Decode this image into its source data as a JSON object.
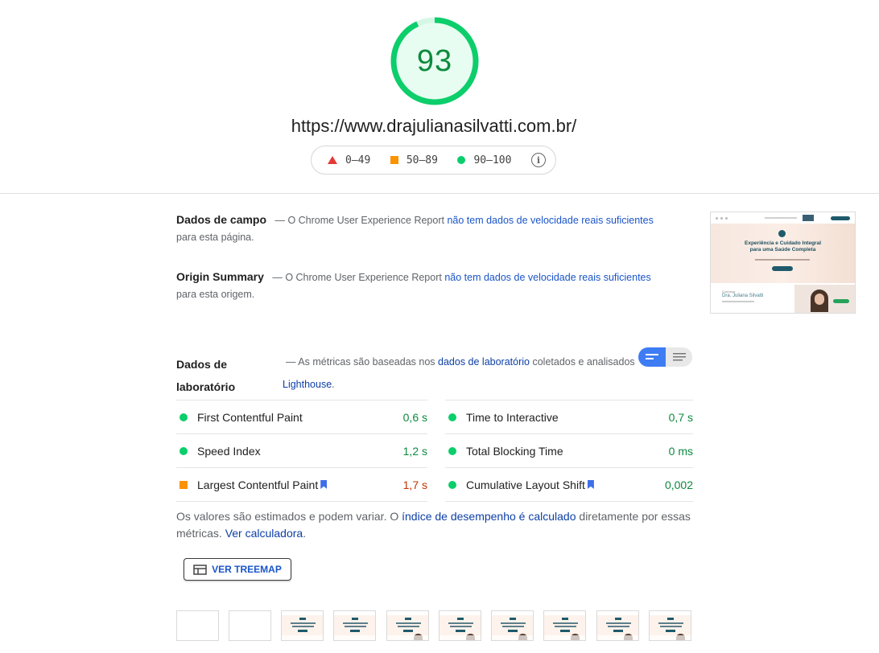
{
  "score": {
    "value": 93,
    "fraction": 0.93,
    "color": "#0cce6b"
  },
  "url": "https://www.drajulianasilvatti.com.br/",
  "legend": {
    "fail": "0–49",
    "average": "50–89",
    "pass": "90–100",
    "info_icon": "info-icon"
  },
  "field_data": {
    "title": "Dados de campo",
    "sep": "—",
    "text_before": "O Chrome User Experience Report",
    "link": "não tem dados de velocidade reais suficientes",
    "text_after": "para esta página."
  },
  "origin_summary": {
    "title": "Origin Summary",
    "sep": "—",
    "text_before": "O Chrome User Experience Report",
    "link": "não tem dados de velocidade reais suficientes",
    "text_after": "para esta origem."
  },
  "lab_data": {
    "title_line1": "Dados de",
    "title_line2": "laboratório",
    "sep": "—",
    "text_before": "As métricas são baseadas nos",
    "link1": "dados de laboratório",
    "text_middle": "coletados e analisados",
    "link2": "Lighthouse",
    "text_end": "."
  },
  "metrics": [
    {
      "name": "First Contentful Paint",
      "value": "0,6 s",
      "status": "pass",
      "bookmark": false
    },
    {
      "name": "Time to Interactive",
      "value": "0,7 s",
      "status": "pass",
      "bookmark": false
    },
    {
      "name": "Speed Index",
      "value": "1,2 s",
      "status": "pass",
      "bookmark": false
    },
    {
      "name": "Total Blocking Time",
      "value": "0 ms",
      "status": "pass",
      "bookmark": false
    },
    {
      "name": "Largest Contentful Paint",
      "value": "1,7 s",
      "status": "average",
      "bookmark": true
    },
    {
      "name": "Cumulative Layout Shift",
      "value": "0,002",
      "status": "pass",
      "bookmark": true
    }
  ],
  "estimate": {
    "text1": "Os valores são estimados e podem variar. O",
    "link1": "índice de desempenho é calculado",
    "text2": "diretamente por essas métricas.",
    "link2": "Ver calculadora",
    "text3": "."
  },
  "treemap_button": "VER TREEMAP",
  "thumbnail": {
    "headline_line1": "Experiência e Cuidado Integral",
    "headline_line2": "para uma Saúde Completa",
    "doctor_name": "Dra. Juliana Silvatti"
  },
  "colors": {
    "pass": "#0c8a3d",
    "average": "#c33300",
    "fail": "#e53935",
    "link": "#1a55c8"
  }
}
